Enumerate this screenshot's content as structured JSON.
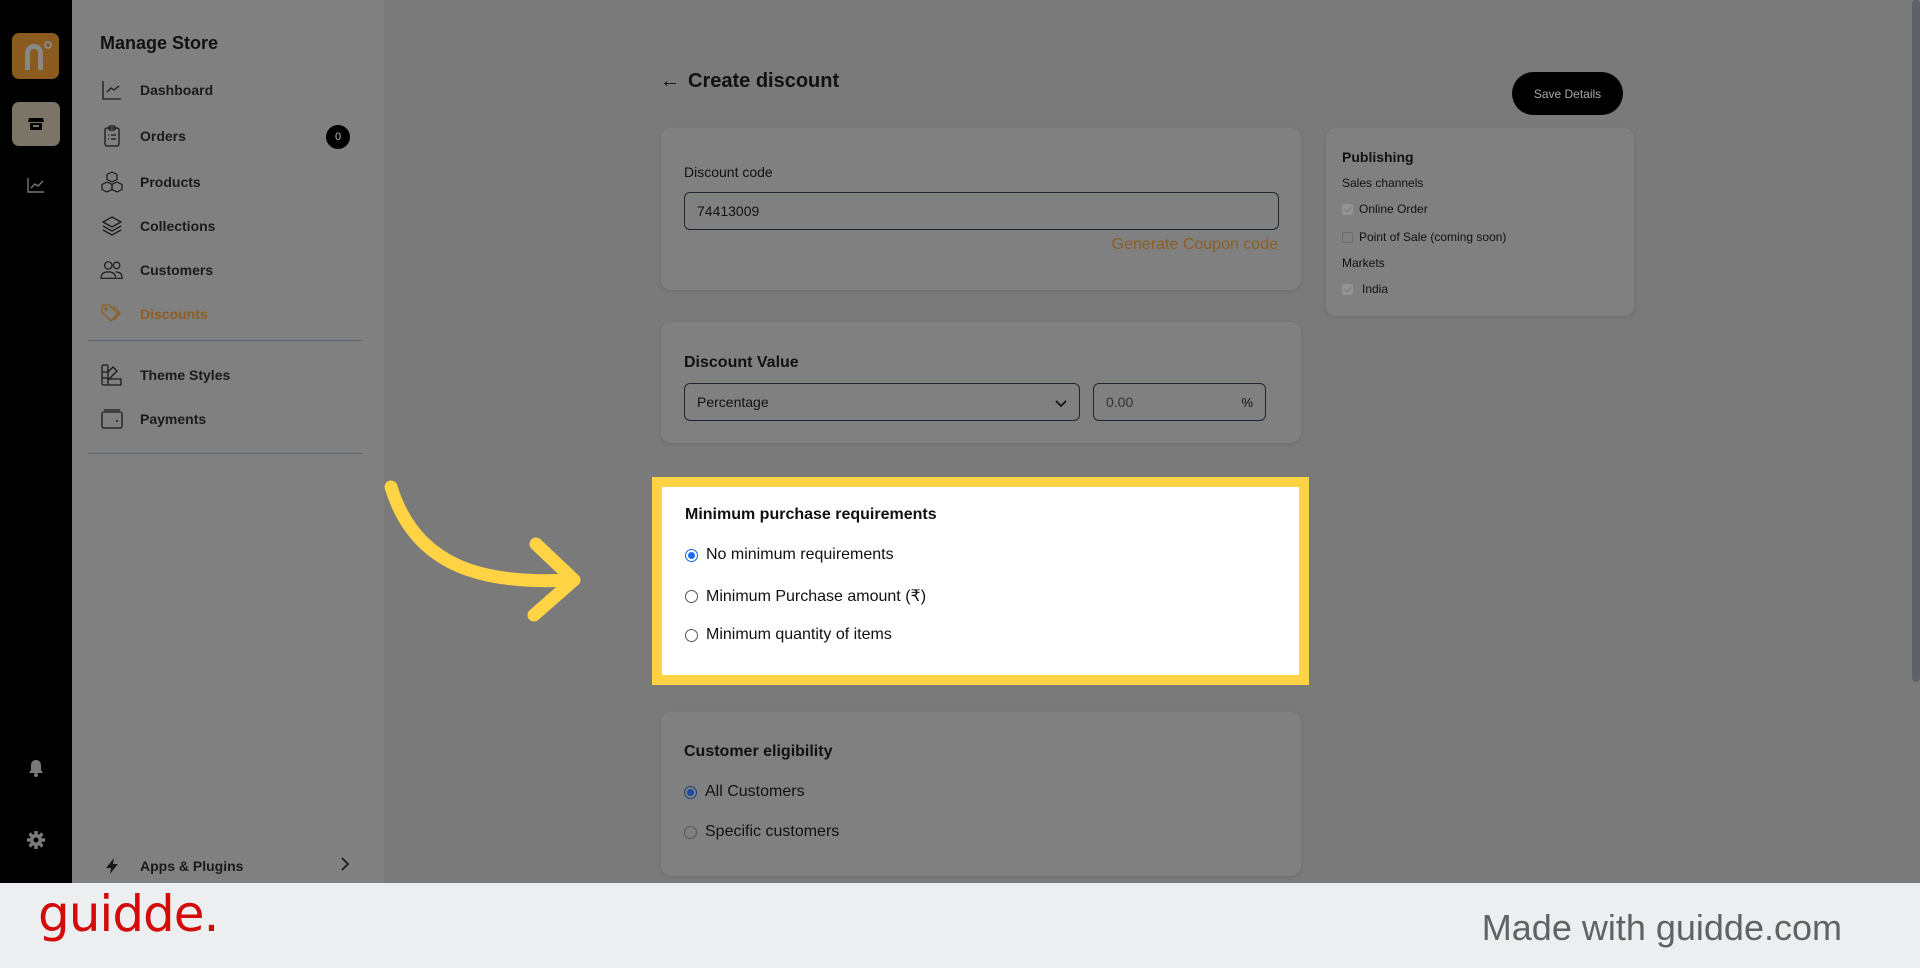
{
  "rail": {
    "icons": [
      "brand-logo",
      "store-icon",
      "analytics-icon",
      "bell-icon",
      "gear-icon"
    ]
  },
  "sidebar": {
    "title": "Manage Store",
    "items": [
      {
        "label": "Dashboard",
        "icon": "chart-line-icon"
      },
      {
        "label": "Orders",
        "icon": "clipboard-icon",
        "badge": "0"
      },
      {
        "label": "Products",
        "icon": "cubes-icon"
      },
      {
        "label": "Collections",
        "icon": "layers-icon"
      },
      {
        "label": "Customers",
        "icon": "users-icon"
      },
      {
        "label": "Discounts",
        "icon": "tag-icon",
        "active": true
      }
    ],
    "items2": [
      {
        "label": "Theme Styles",
        "icon": "swatch-icon"
      },
      {
        "label": "Payments",
        "icon": "wallet-icon"
      }
    ],
    "apps": {
      "label": "Apps & Plugins",
      "icon": "bolt-icon"
    }
  },
  "header": {
    "back": "←",
    "title": "Create discount",
    "save_label": "Save Details"
  },
  "discount_code": {
    "label": "Discount code",
    "value": "74413009",
    "generate_label": "Generate Coupon code"
  },
  "discount_value": {
    "title": "Discount Value",
    "type_selected": "Percentage",
    "amount_placeholder": "0.00",
    "suffix": "%"
  },
  "min_purchase": {
    "title": "Minimum purchase requirements",
    "options": [
      {
        "label": "No minimum requirements",
        "selected": true
      },
      {
        "label": "Minimum Purchase amount (₹)",
        "selected": false
      },
      {
        "label": "Minimum quantity of items",
        "selected": false
      }
    ]
  },
  "eligibility": {
    "title": "Customer eligibility",
    "options": [
      {
        "label": "All Customers",
        "selected": true
      },
      {
        "label": "Specific customers",
        "selected": false
      }
    ]
  },
  "publishing": {
    "title": "Publishing",
    "sales_channels_label": "Sales channels",
    "channels": [
      {
        "label": "Online Order",
        "checked": true
      },
      {
        "label": "Point of Sale (coming soon)",
        "checked": false
      }
    ],
    "markets_label": "Markets",
    "markets": [
      {
        "label": "India",
        "checked": true
      }
    ]
  },
  "colors": {
    "accent": "#8f5e22",
    "highlight": "#ffd343",
    "brand_red": "#d20a0a"
  },
  "footer": {
    "logo": "guidde.",
    "tagline": "Made with guidde.com"
  }
}
